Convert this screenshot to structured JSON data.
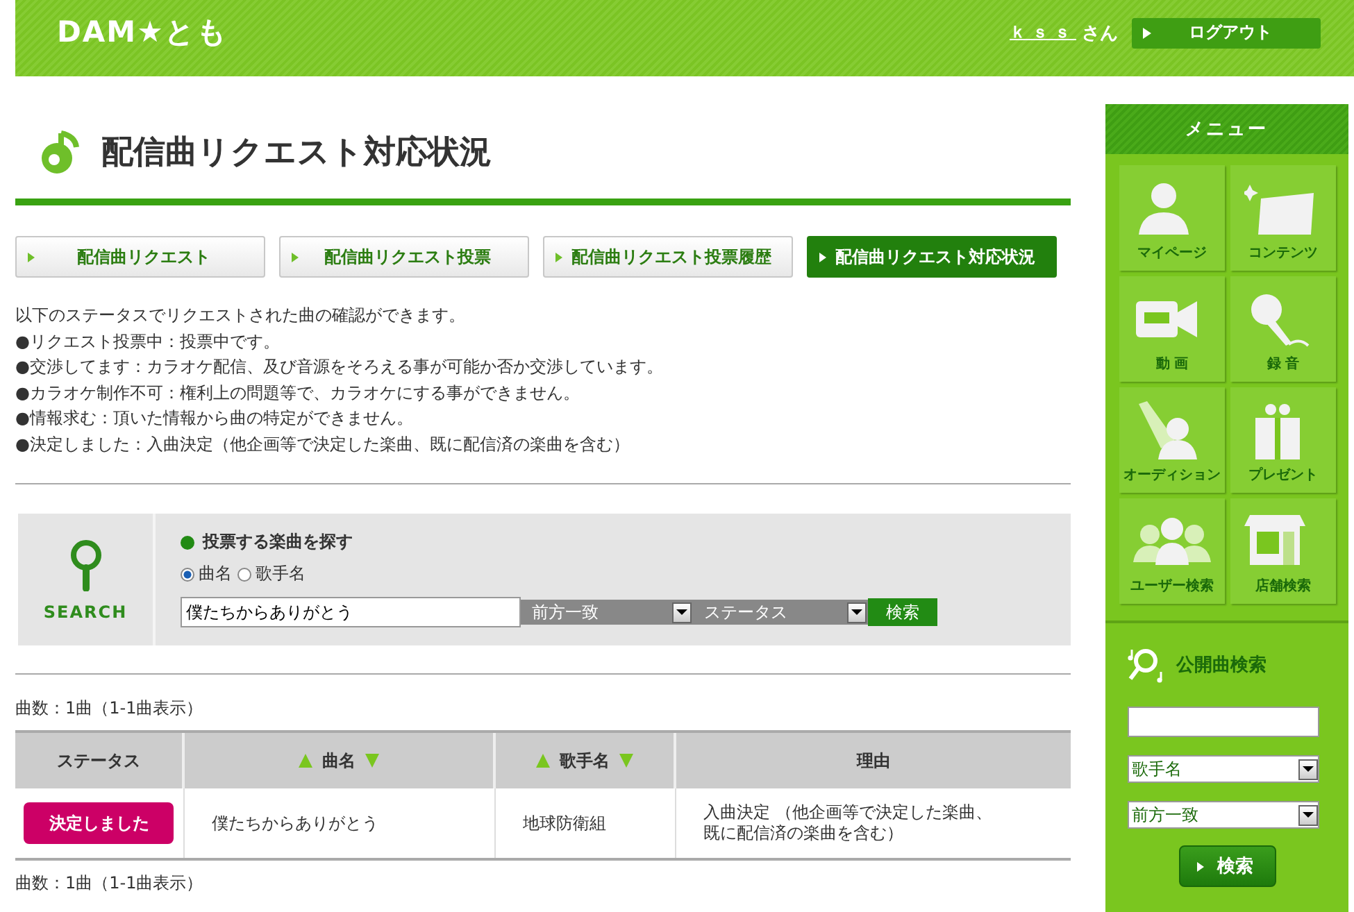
{
  "header": {
    "logo": "DAM★とも",
    "user": "ｋｓｓ",
    "honorific": "さん",
    "logout": "ログアウト"
  },
  "page_title": "配信曲リクエスト対応状況",
  "tabs": [
    {
      "label": "配信曲リクエスト",
      "selected": false
    },
    {
      "label": "配信曲リクエスト投票",
      "selected": false
    },
    {
      "label": "配信曲リクエスト投票履歴",
      "selected": false
    },
    {
      "label": "配信曲リクエスト対応状況",
      "selected": true
    }
  ],
  "intro": [
    "以下のステータスでリクエストされた曲の確認ができます。",
    "●リクエスト投票中：投票中です。",
    "●交渉してます：カラオケ配信、及び音源をそろえる事が可能か否か交渉しています。",
    "●カラオケ制作不可：権利上の問題等で、カラオケにする事ができません。",
    "●情報求む：頂いた情報から曲の特定ができません。",
    "●決定しました：入曲決定（他企画等で決定した楽曲、既に配信済の楽曲を含む）"
  ],
  "search": {
    "label": "SEARCH",
    "heading": "投票する楽曲を探す",
    "radios": [
      {
        "label": "曲名",
        "selected": true
      },
      {
        "label": "歌手名",
        "selected": false
      }
    ],
    "query": "僕たちからありがとう",
    "match": "前方一致",
    "status": "ステータス",
    "button": "検索"
  },
  "count_top": "曲数：1曲（1-1曲表示）",
  "table": {
    "columns": [
      {
        "label": "ステータス",
        "sortable": false
      },
      {
        "label": "曲名",
        "sortable": true
      },
      {
        "label": "歌手名",
        "sortable": true
      },
      {
        "label": "理由",
        "sortable": false
      }
    ],
    "rows": [
      {
        "status": "決定しました",
        "color": "#cc0066",
        "song": "僕たちからありがとう",
        "artist": "地球防衛組",
        "reason": "入曲決定 （他企画等で決定した楽曲、既に配信済の楽曲を含む）"
      }
    ]
  },
  "count_bottom": "曲数：1曲（1-1曲表示）",
  "sidebar": {
    "title": "メニュー",
    "items": [
      {
        "label": "マイページ",
        "kind": "person"
      },
      {
        "label": "コンテンツ",
        "kind": "ticket"
      },
      {
        "label": "動 画",
        "kind": "camera"
      },
      {
        "label": "録 音",
        "kind": "mic"
      },
      {
        "label": "オーディション",
        "kind": "spotlight"
      },
      {
        "label": "プレゼント",
        "kind": "gift"
      },
      {
        "label": "ユーザー検索",
        "kind": "people"
      },
      {
        "label": "店舗検索",
        "kind": "shop"
      }
    ],
    "public_search": {
      "title": "公開曲検索",
      "field_select": "歌手名",
      "match_select": "前方一致",
      "button": "検索"
    }
  }
}
